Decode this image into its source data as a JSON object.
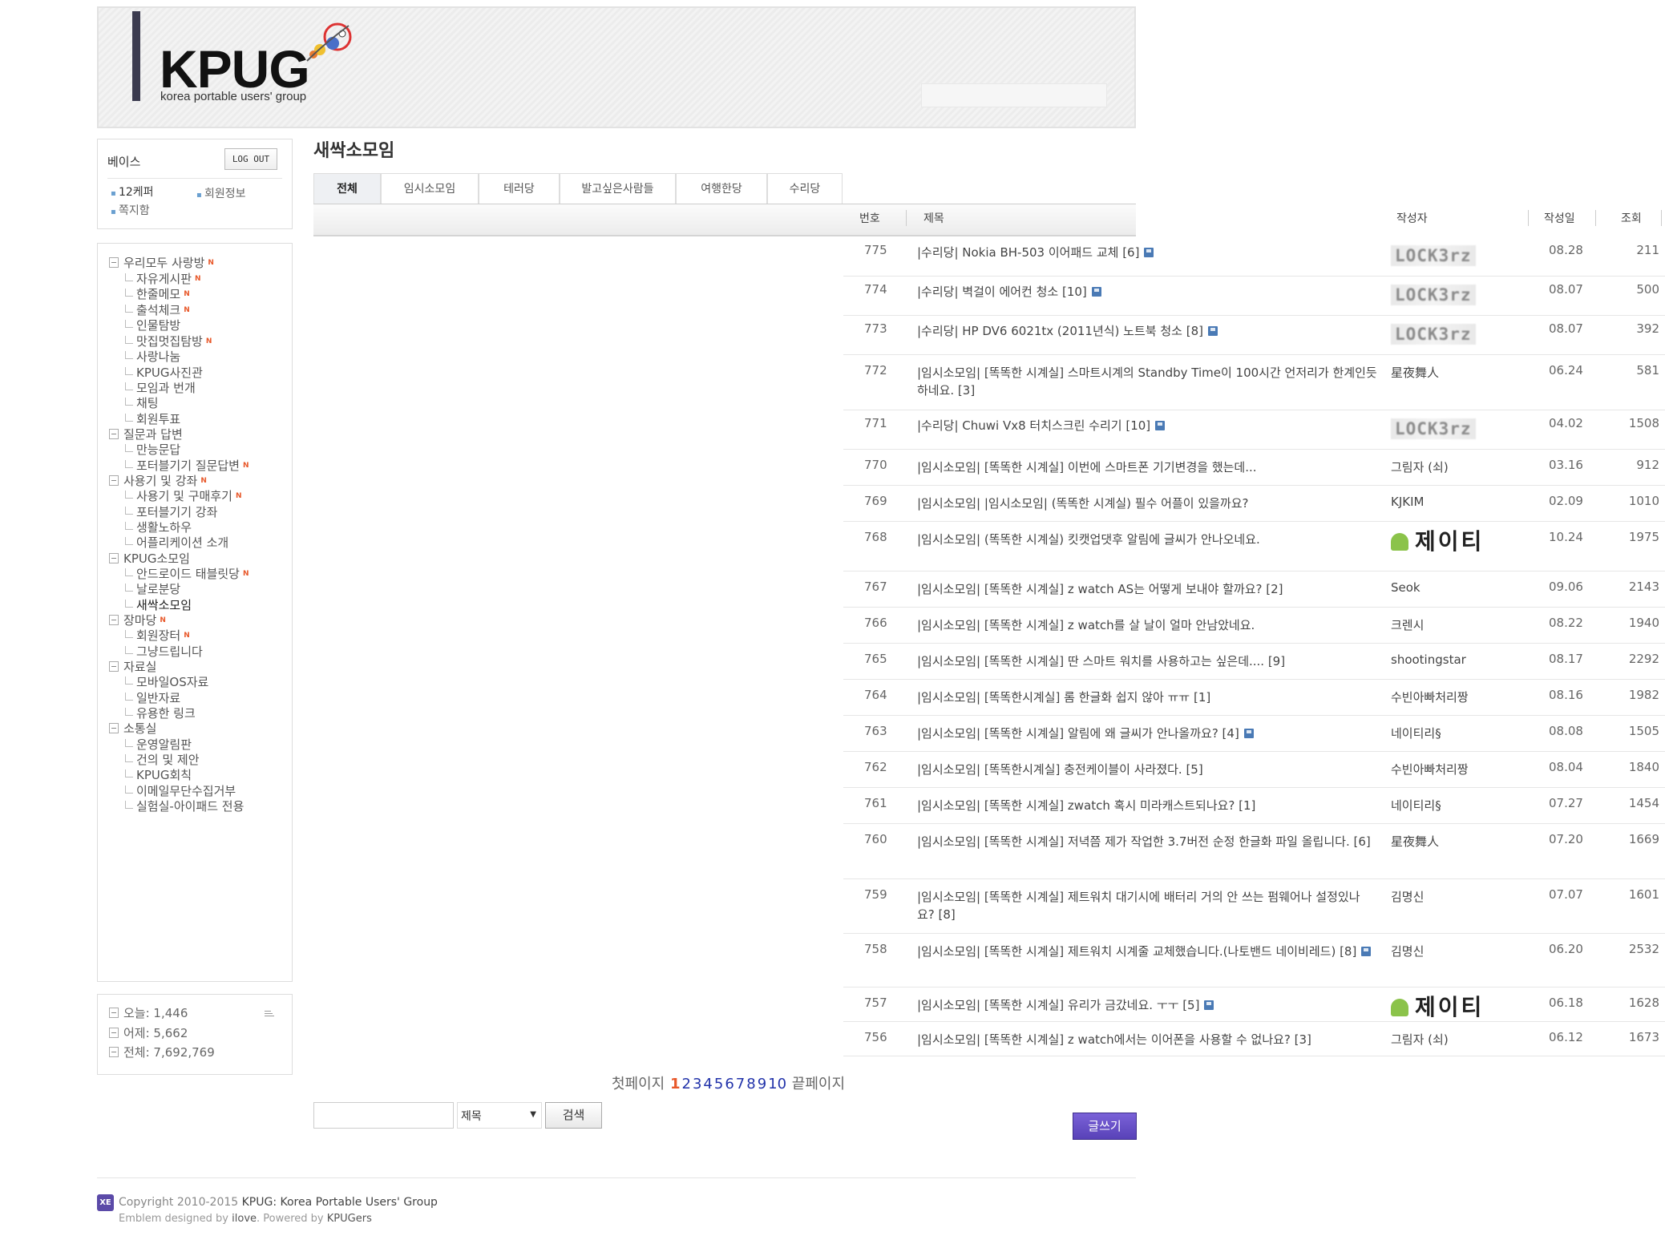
{
  "header": {
    "logo_text": "KPUG",
    "logo_sub": "korea portable users' group"
  },
  "login": {
    "user_name": "베이스",
    "logout_label": "LOG OUT",
    "karma": "12케퍼",
    "member_info": "회원정보",
    "messages": "쪽지함"
  },
  "menu": [
    {
      "label": "우리모두 사랑방",
      "level": 0,
      "new": true
    },
    {
      "label": "자유게시판",
      "level": 1,
      "new": true
    },
    {
      "label": "한줄메모",
      "level": 1,
      "new": true
    },
    {
      "label": "출석체크",
      "level": 1,
      "new": true
    },
    {
      "label": "인물탐방",
      "level": 1,
      "new": false
    },
    {
      "label": "맛집멋집탐방",
      "level": 1,
      "new": true
    },
    {
      "label": "사랑나눔",
      "level": 1,
      "new": false
    },
    {
      "label": "KPUG사진관",
      "level": 1,
      "new": false
    },
    {
      "label": "모임과 번개",
      "level": 1,
      "new": false
    },
    {
      "label": "채팅",
      "level": 1,
      "new": false
    },
    {
      "label": "회원투표",
      "level": 1,
      "new": false
    },
    {
      "label": "질문과 답변",
      "level": 0,
      "new": false
    },
    {
      "label": "만능문답",
      "level": 1,
      "new": false
    },
    {
      "label": "포터블기기 질문답변",
      "level": 1,
      "new": true
    },
    {
      "label": "사용기 및 강좌",
      "level": 0,
      "new": true
    },
    {
      "label": "사용기 및 구매후기",
      "level": 1,
      "new": true
    },
    {
      "label": "포터블기기 강좌",
      "level": 1,
      "new": false
    },
    {
      "label": "생활노하우",
      "level": 1,
      "new": false
    },
    {
      "label": "어플리케이션 소개",
      "level": 1,
      "new": false
    },
    {
      "label": "KPUG소모임",
      "level": 0,
      "new": false
    },
    {
      "label": "안드로이드 태블릿당",
      "level": 1,
      "new": true
    },
    {
      "label": "날로분당",
      "level": 1,
      "new": false
    },
    {
      "label": "새싹소모임",
      "level": 1,
      "new": false,
      "active": true
    },
    {
      "label": "장마당",
      "level": 0,
      "new": true
    },
    {
      "label": "회원장터",
      "level": 1,
      "new": true
    },
    {
      "label": "그냥드립니다",
      "level": 1,
      "new": false
    },
    {
      "label": "자료실",
      "level": 0,
      "new": false
    },
    {
      "label": "모바일OS자료",
      "level": 1,
      "new": false
    },
    {
      "label": "일반자료",
      "level": 1,
      "new": false
    },
    {
      "label": "유용한 링크",
      "level": 1,
      "new": false
    },
    {
      "label": "소통실",
      "level": 0,
      "new": false
    },
    {
      "label": "운영알림판",
      "level": 1,
      "new": false
    },
    {
      "label": "건의 및 제안",
      "level": 1,
      "new": false
    },
    {
      "label": "KPUG회칙",
      "level": 1,
      "new": false
    },
    {
      "label": "이메일무단수집거부",
      "level": 1,
      "new": false
    },
    {
      "label": "실험실-아이패드 전용",
      "level": 1,
      "new": false
    }
  ],
  "counter": {
    "today": "오늘: 1,446",
    "yesterday": "어제: 5,662",
    "total": "전체: 7,692,769"
  },
  "board": {
    "title": "새싹소모임",
    "tabs": [
      "전체",
      "임시소모임",
      "테러당",
      "발고싶은사람들",
      "여행한당",
      "수리당"
    ],
    "columns": {
      "num": "번호",
      "title": "제목",
      "author": "작성자",
      "date": "작성일",
      "views": "조회"
    },
    "rows": [
      {
        "num": "775",
        "title": "|수리당| Nokia BH-503 이어패드 교체 [6]",
        "file": true,
        "author": "LOCK3rz",
        "author_img": "blur",
        "date": "08.28",
        "views": "211"
      },
      {
        "num": "774",
        "title": "|수리당| 벽걸이 에어컨 청소 [10]",
        "file": true,
        "author": "LOCK3rz",
        "author_img": "blur",
        "date": "08.07",
        "views": "500"
      },
      {
        "num": "773",
        "title": "|수리당| HP DV6 6021tx (2011년식) 노트북 청소 [8]",
        "file": true,
        "author": "LOCK3rz",
        "author_img": "blur",
        "date": "08.07",
        "views": "392"
      },
      {
        "num": "772",
        "title": "|임시소모임| [똑똑한 시계실] 스마트시계의 Standby Time이 100시간 언저리가 한계인듯 하네요. [3]",
        "file": false,
        "author": "星夜舞人",
        "author_img": "",
        "date": "06.24",
        "views": "581"
      },
      {
        "num": "771",
        "title": "|수리당| Chuwi Vx8 터치스크린 수리기 [10]",
        "file": true,
        "author": "LOCK3rz",
        "author_img": "blur",
        "date": "04.02",
        "views": "1508"
      },
      {
        "num": "770",
        "title": "|임시소모임| [똑똑한 시계실] 이번에 스마트폰 기기변경을 했는데...",
        "file": false,
        "author": "그림자 (쇠)",
        "author_img": "",
        "date": "03.16",
        "views": "912"
      },
      {
        "num": "769",
        "title": "|임시소모임| |임시소모임| (똑똑한 시계실) 필수 어플이 있을까요?",
        "file": false,
        "author": "KJKIM",
        "author_img": "",
        "date": "02.09",
        "views": "1010"
      },
      {
        "num": "768",
        "title": "|임시소모임| (똑똑한 시계실) 킷캣업댓후 알림에 글씨가 안나오네요.",
        "file": false,
        "author": "제이티",
        "author_img": "droid",
        "date": "10.24",
        "views": "1975"
      },
      {
        "num": "767",
        "title": "|임시소모임| [똑똑한 시계실] z watch AS는 어떻게 보내야 할까요? [2]",
        "file": false,
        "author": "Seok",
        "author_img": "",
        "date": "09.06",
        "views": "2143"
      },
      {
        "num": "766",
        "title": "|임시소모임| [똑똑한 시계실] z watch를 살 날이 얼마 안남았네요.",
        "file": false,
        "author": "크렌시",
        "author_img": "",
        "date": "08.22",
        "views": "1940"
      },
      {
        "num": "765",
        "title": "|임시소모임| [똑똑한 시계실] 딴 스마트 워치를 사용하고는 싶은데.... [9]",
        "file": false,
        "author": "shootingstar",
        "author_img": "",
        "date": "08.17",
        "views": "2292"
      },
      {
        "num": "764",
        "title": "|임시소모임| [똑똑한시계실] 롬 한글화 쉽지 않아 ㅠㅠ [1]",
        "file": false,
        "author": "수빈아빠처리짱",
        "author_img": "",
        "date": "08.16",
        "views": "1982"
      },
      {
        "num": "763",
        "title": "|임시소모임| [똑똑한 시계실] 알림에 왜 글씨가 안나올까요? [4]",
        "file": true,
        "author": "네이티리§",
        "author_img": "",
        "date": "08.08",
        "views": "1505"
      },
      {
        "num": "762",
        "title": "|임시소모임| [똑똑한시계실] 충전케이블이 사라졌다. [5]",
        "file": false,
        "author": "수빈아빠처리짱",
        "author_img": "",
        "date": "08.04",
        "views": "1840"
      },
      {
        "num": "761",
        "title": "|임시소모임| [똑똑한 시계실] zwatch 혹시 미라캐스트되나요? [1]",
        "file": false,
        "author": "네이티리§",
        "author_img": "",
        "date": "07.27",
        "views": "1454"
      },
      {
        "num": "760",
        "title": "|임시소모임| [똑똑한 시계실] 저녁쯤 제가 작업한 3.7버전 순정 한글화 파일 올립니다. [6]",
        "file": false,
        "author": "星夜舞人",
        "author_img": "",
        "date": "07.20",
        "views": "1669"
      },
      {
        "num": "759",
        "title": "|임시소모임| [똑똑한 시계실] 제트워치 대기시에 배터리 거의 안 쓰는 펌웨어나 설정있나요? [8]",
        "file": false,
        "author": "김명신",
        "author_img": "",
        "date": "07.07",
        "views": "1601"
      },
      {
        "num": "758",
        "title": "|임시소모임| [똑똑한 시계실] 제트워치 시계줄 교체했습니다.(나토밴드 네이비레드) [8]",
        "file": true,
        "author": "김명신",
        "author_img": "",
        "date": "06.20",
        "views": "2532"
      },
      {
        "num": "757",
        "title": "|임시소모임| [똑똑한 시계실] 유리가 금갔네요. ㅜㅜ [5]",
        "file": true,
        "author": "제이티",
        "author_img": "droid",
        "date": "06.18",
        "views": "1628"
      },
      {
        "num": "756",
        "title": "|임시소모임| [똑똑한 시계실] z watch에서는 이어폰을 사용할 수 없나요? [3]",
        "file": false,
        "author": "그림자 (쇠)",
        "author_img": "",
        "date": "06.12",
        "views": "1673"
      }
    ]
  },
  "pagination": {
    "first": "첫페이지",
    "pages": [
      "1",
      "2",
      "3",
      "4",
      "5",
      "6",
      "7",
      "8",
      "9",
      "10"
    ],
    "current": "1",
    "last": "끝페이지"
  },
  "search": {
    "select_value": "제목",
    "button_label": "검색"
  },
  "write_label": "글쓰기",
  "footer": {
    "xe": "XE",
    "copyright_prefix": "Copyright 2010-2015",
    "copyright_name": "KPUG: Korea Portable Users' Group",
    "credits_prefix": "Emblem designed by",
    "credits_designer": "ilove",
    "credits_mid": ". Powered by",
    "credits_powered": "KPUGers"
  },
  "colors": {
    "new_badge": "#e8582a",
    "write_button": "#5842b8",
    "page_link": "#2233aa",
    "current_page": "#e8582a"
  }
}
